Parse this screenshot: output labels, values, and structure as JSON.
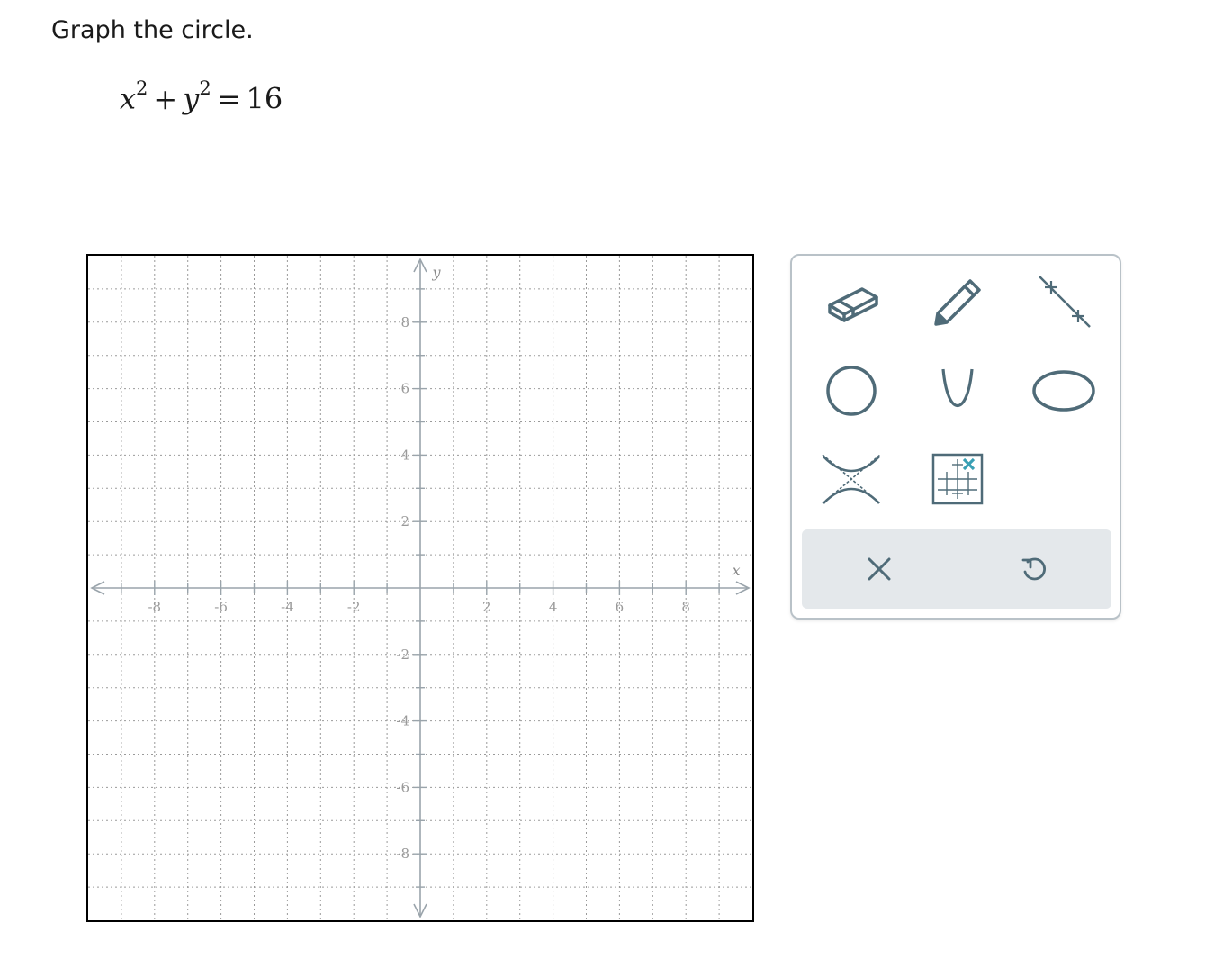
{
  "question": {
    "prompt": "Graph the circle.",
    "equation": {
      "x": "x",
      "y": "y",
      "exp": "2",
      "plus": "+",
      "equals": "=",
      "rhs": "16"
    }
  },
  "graph": {
    "x_axis_label": "x",
    "y_axis_label": "y",
    "x_range": [
      -10,
      10
    ],
    "y_range": [
      -10,
      10
    ],
    "grid": "dotted",
    "x_tick_labels": [
      "-8",
      "-6",
      "-4",
      "-2",
      "2",
      "4",
      "6",
      "8"
    ],
    "y_tick_labels": [
      "8",
      "6",
      "4",
      "2",
      "-2",
      "-4",
      "-6",
      "-8"
    ]
  },
  "toolbox": {
    "tools": [
      {
        "name": "eraser-tool",
        "icon": "eraser-icon"
      },
      {
        "name": "pencil-tool",
        "icon": "pencil-icon"
      },
      {
        "name": "line-tool",
        "icon": "line-icon"
      },
      {
        "name": "circle-tool",
        "icon": "circle-icon"
      },
      {
        "name": "parabola-tool",
        "icon": "parabola-icon"
      },
      {
        "name": "ellipse-tool",
        "icon": "ellipse-icon"
      },
      {
        "name": "hyperbola-tool",
        "icon": "hyperbola-icon"
      },
      {
        "name": "point-tool",
        "icon": "grid-point-icon"
      }
    ],
    "actions": [
      {
        "name": "clear-button",
        "icon": "close-icon"
      },
      {
        "name": "undo-button",
        "icon": "undo-icon"
      }
    ]
  },
  "colors": {
    "icon": "#4f6b78",
    "accent": "#3aa0b5",
    "grid": "#9a9a9a",
    "axis": "#9aa4ab",
    "action_bar": "#e4e8eb",
    "toolbox_border": "#b9c2c8"
  }
}
